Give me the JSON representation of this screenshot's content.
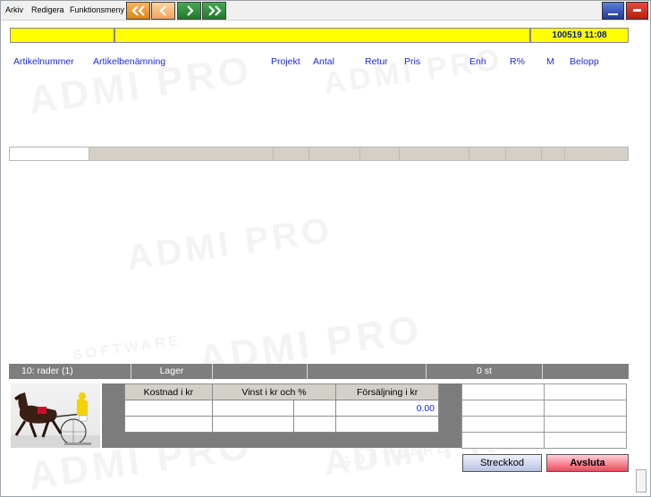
{
  "menu": {
    "items": [
      {
        "label": "Arkiv"
      },
      {
        "label": "Redigera"
      },
      {
        "label": "Funktionsmeny"
      }
    ]
  },
  "toolbar": {
    "nav": [
      {
        "icon": "double-chevron-left-icon",
        "color": "#e08512"
      },
      {
        "icon": "chevron-left-icon",
        "color": "#f4a45b"
      },
      {
        "icon": "chevron-right-icon",
        "color": "#1f7a2c"
      },
      {
        "icon": "double-chevron-right-icon",
        "color": "#1f7a2c"
      }
    ]
  },
  "status": {
    "datetime": "100519 11:08"
  },
  "columns": [
    {
      "label": "Artikelnummer"
    },
    {
      "label": "Artikelbenämning"
    },
    {
      "label": "Projekt"
    },
    {
      "label": "Antal"
    },
    {
      "label": "Retur"
    },
    {
      "label": "Pris"
    },
    {
      "label": "Enh"
    },
    {
      "label": "R%"
    },
    {
      "label": "M"
    },
    {
      "label": "Belopp"
    }
  ],
  "info_bar": {
    "rows": "10: rader (1)",
    "stock_label": "Lager",
    "count": "0 st"
  },
  "totals": {
    "headers": {
      "cost": "Kostnad i kr",
      "profit": "Vinst i kr och %",
      "sales": "Försäljning i kr"
    },
    "sales_value": "0.00"
  },
  "buttons": {
    "barcode": "Streckkod",
    "exit": "Avsluta"
  },
  "colors": {
    "status_bar": "#ffff00",
    "header_text": "#1a2ae0",
    "exit_button": "#ee4a5a",
    "barcode_button": "#b8c3e3"
  },
  "watermark": {
    "brand": "ADMI PRO",
    "subtitle": "SOFTWARE"
  }
}
